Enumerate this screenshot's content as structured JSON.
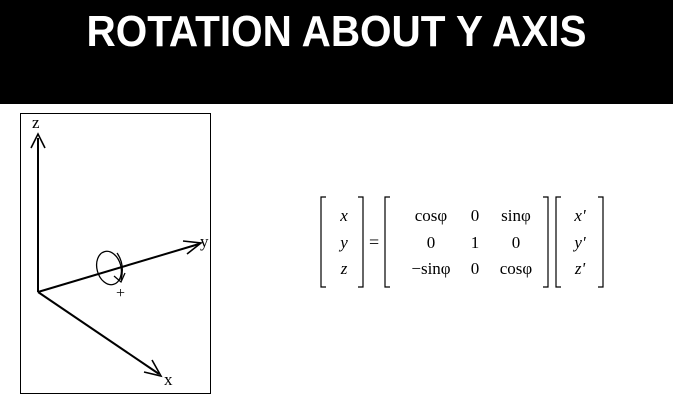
{
  "title": "ROTATION ABOUT Y AXIS",
  "axes": {
    "z_label": "z",
    "y_label": "y",
    "x_label": "x",
    "rotation_sign": "+"
  },
  "equation": {
    "lhs": [
      "x",
      "y",
      "z"
    ],
    "equals": "=",
    "matrix": [
      [
        "cosφ",
        "0",
        "sinφ"
      ],
      [
        "0",
        "1",
        "0"
      ],
      [
        "−sinφ",
        "0",
        "cosφ"
      ]
    ],
    "rhs": [
      "x'",
      "y'",
      "z'"
    ]
  }
}
